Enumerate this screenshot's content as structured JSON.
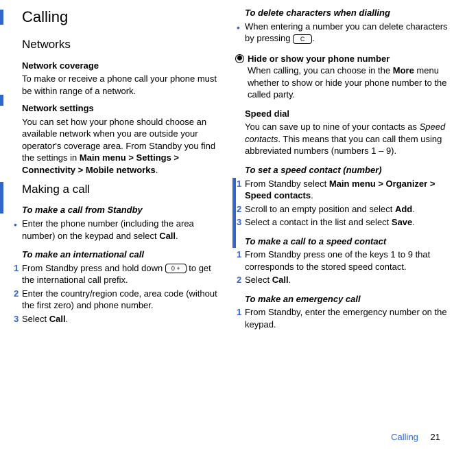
{
  "left": {
    "title": "Calling",
    "networks_heading": "Networks",
    "coverage_head": "Network coverage",
    "coverage_text": "To make or receive a phone call your phone must be within range of a network.",
    "settings_head": "Network settings",
    "settings_text_1": "You can set how your phone should choose an available network when you are outside your operator's coverage area. From Standby you find the settings in ",
    "settings_bold": "Main menu > Settings > Connectivity > Mobile networks",
    "settings_text_2": ".",
    "making_call": "Making a call",
    "standby_head": "To make a call from Standby",
    "standby_text_1": "Enter the phone number (including the area number) on the keypad and select ",
    "standby_bold": "Call",
    "standby_text_2": ".",
    "intl_head": "To make an international call",
    "intl_step1_a": "From Standby press and hold down ",
    "intl_step1_key": "0 +",
    "intl_step1_b": " to get the international call prefix.",
    "intl_step2": "Enter the country/region code, area code (without the first zero) and phone number.",
    "intl_step3_a": "Select ",
    "intl_step3_bold": "Call",
    "intl_step3_b": "."
  },
  "right": {
    "delete_head": "To delete characters when dialling",
    "delete_text_a": "When entering a number you can delete characters by pressing ",
    "delete_key": "C",
    "delete_text_b": ".",
    "tip_head": "Hide or show your phone number",
    "tip_text_a": "When calling, you can choose in the ",
    "tip_bold": "More",
    "tip_text_b": " menu whether to show or hide your phone number to the called party.",
    "speed_head": "Speed dial",
    "speed_text_a": "You can save up to nine of your contacts as ",
    "speed_ital": "Speed contacts",
    "speed_text_b": ". This means that you can call them using abbreviated numbers (numbers 1 – 9).",
    "set_head": "To set a speed contact (number)",
    "set_step1_a": "From Standby select ",
    "set_step1_bold": "Main menu > Organizer > Speed contacts",
    "set_step1_b": ".",
    "set_step2_a": "Scroll to an empty position and select ",
    "set_step2_bold": "Add",
    "set_step2_b": ".",
    "set_step3_a": "Select a contact in the list and select ",
    "set_step3_bold": "Save",
    "set_step3_b": ".",
    "call_speed_head": "To make a call to a speed contact",
    "call_speed_step1": "From Standby press one of the keys 1 to 9 that corresponds to the stored speed contact.",
    "call_speed_step2_a": "Select ",
    "call_speed_step2_bold": "Call",
    "call_speed_step2_b": ".",
    "emerg_head": "To make an emergency call",
    "emerg_step1": "From Standby, enter the emergency number on the keypad."
  },
  "footer": {
    "label": "Calling",
    "page": "21"
  },
  "step_nums": {
    "n1": "1",
    "n2": "2",
    "n3": "3"
  },
  "bullet": "•",
  "tip_icon": "⦚"
}
